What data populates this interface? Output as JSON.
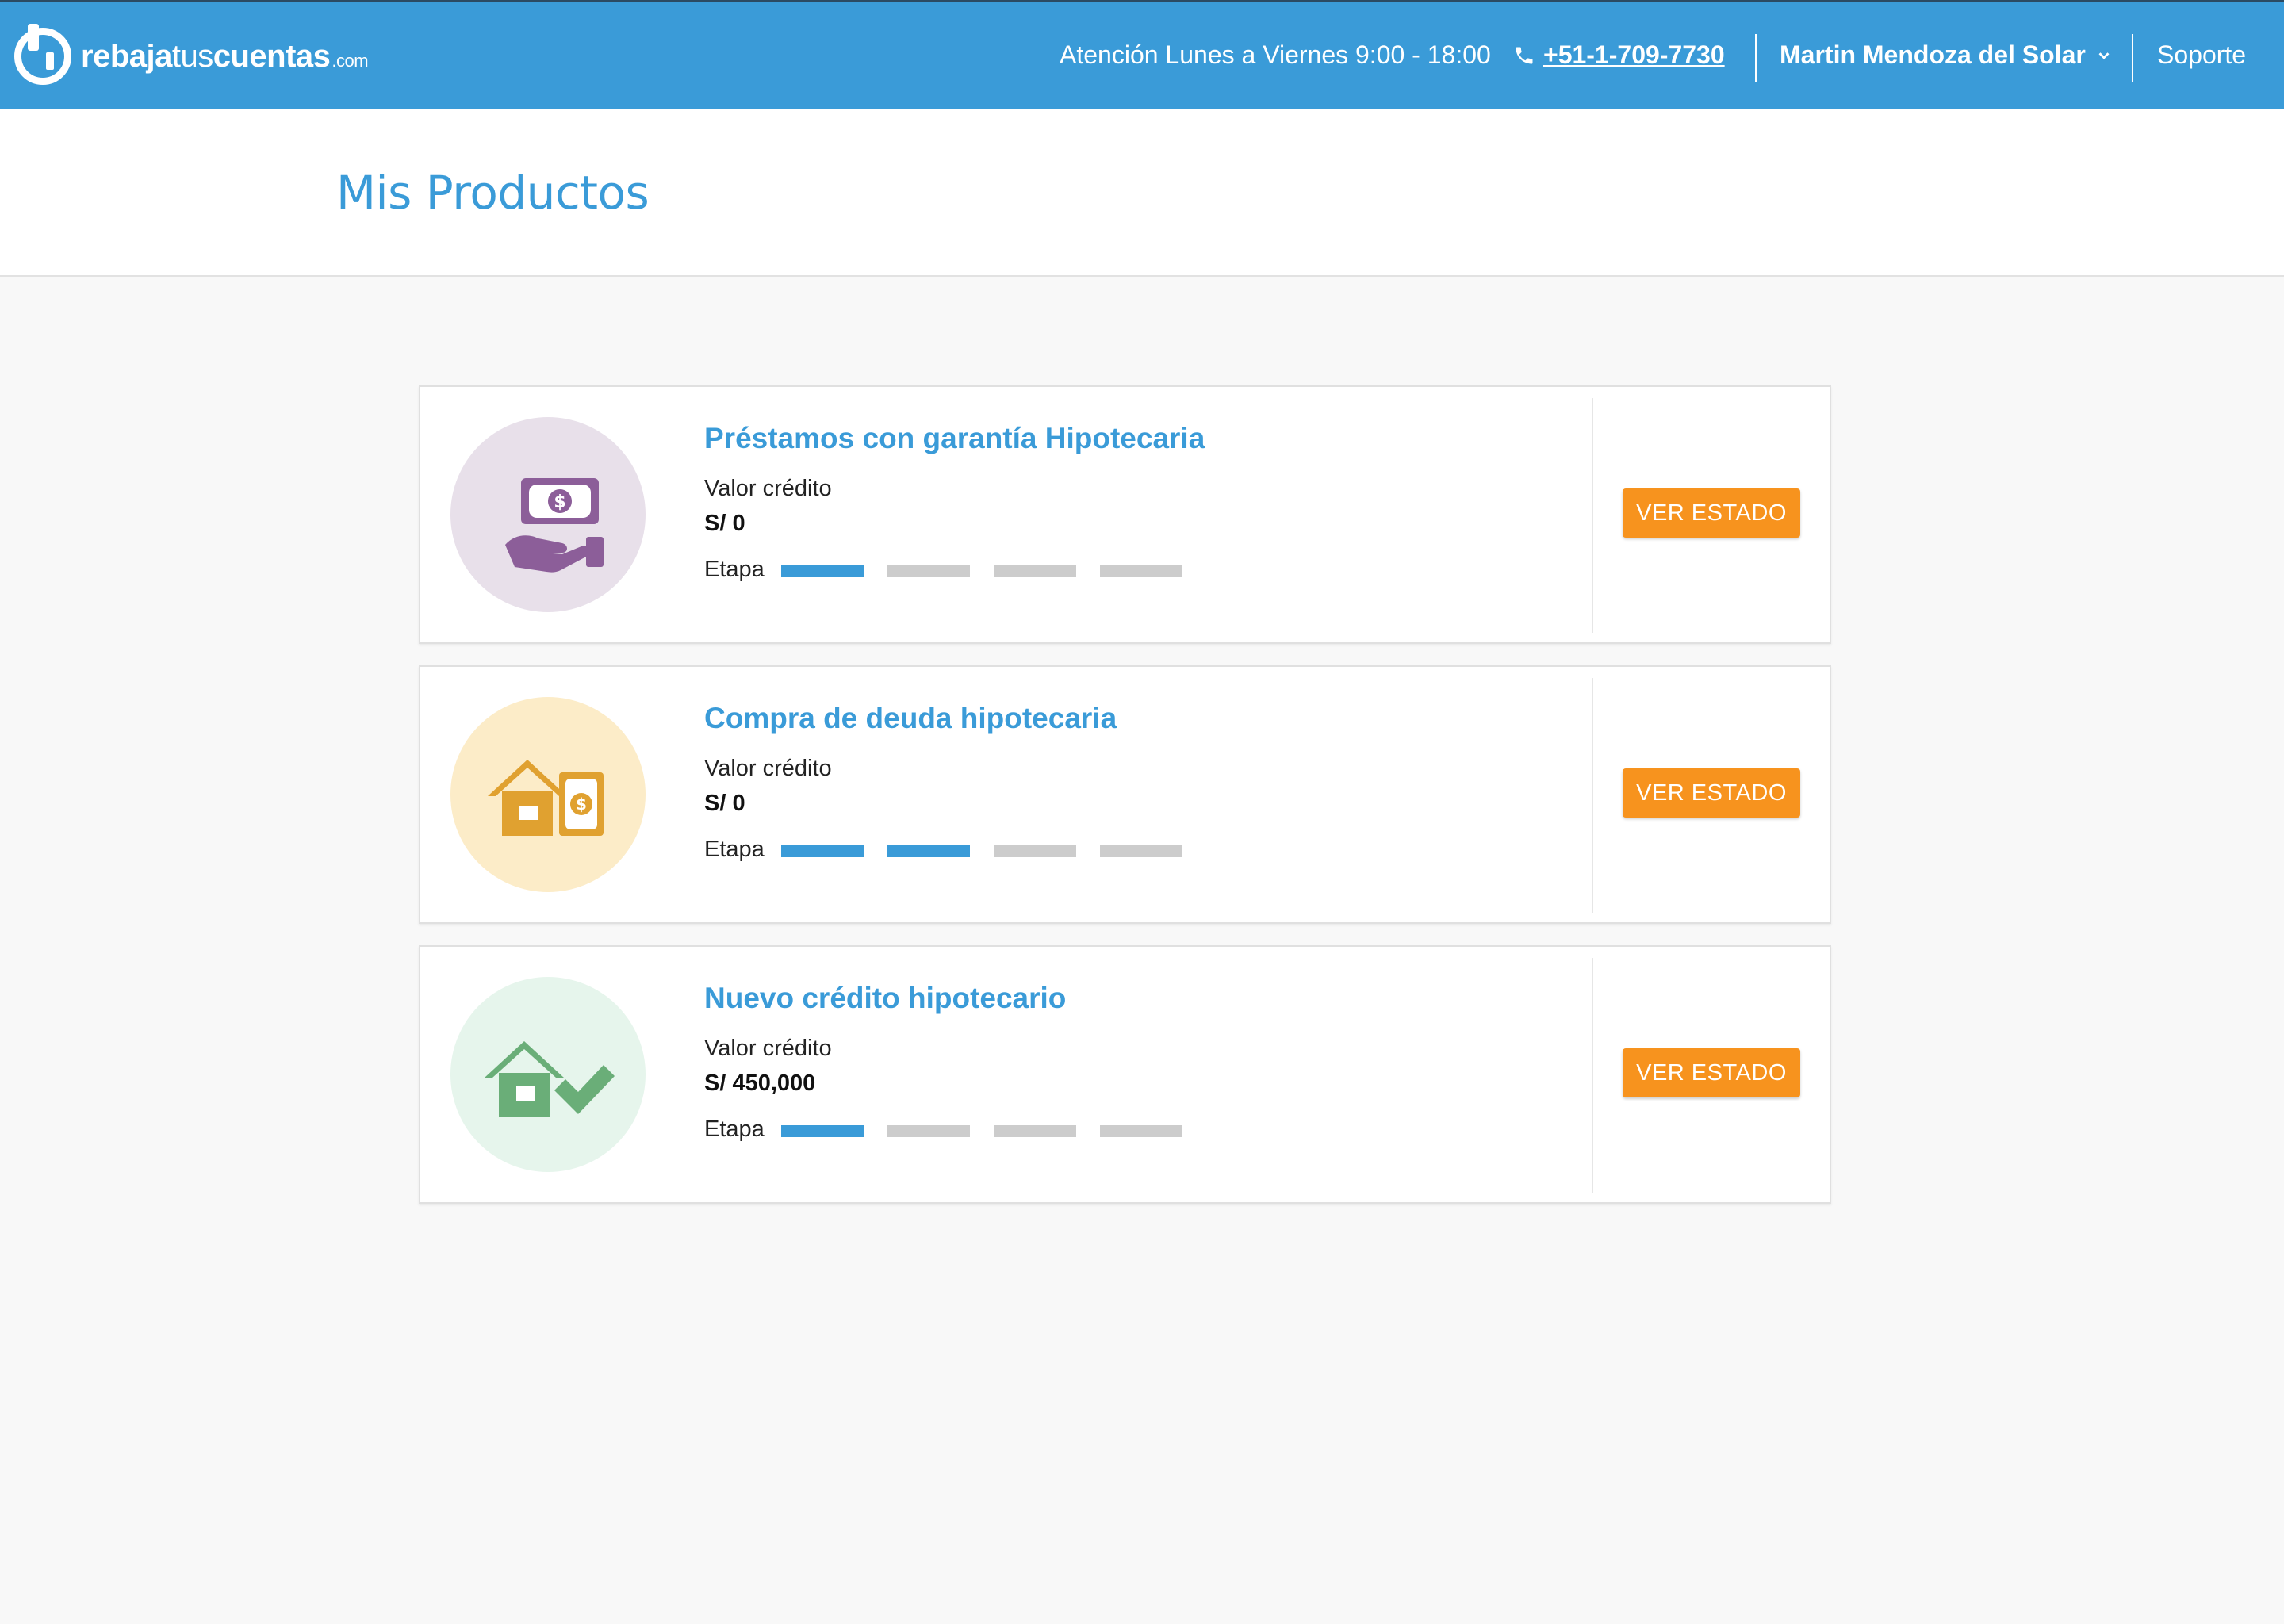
{
  "header": {
    "logo": {
      "bold": "rebaja",
      "thin": "tus",
      "bold2": "cuentas",
      "suffix": ".com"
    },
    "hours": "Atención Lunes a Viernes 9:00 - 18:00",
    "phone": "+51-1-709-7730",
    "user_name": "Martin Mendoza del Solar",
    "support": "Soporte",
    "bg_color": "#3a9bd8"
  },
  "page": {
    "title": "Mis Productos"
  },
  "products": [
    {
      "title": "Préstamos con garantía Hipotecaria",
      "value_label": "Valor crédito",
      "value": "S/ 0",
      "stage_label": "Etapa",
      "stage_done": 1,
      "stage_total": 4,
      "button": "VER ESTADO",
      "icon": "money-hand-icon",
      "icon_bg": "#e8e0ea",
      "icon_color": "#8c5e99"
    },
    {
      "title": "Compra de deuda hipotecaria",
      "value_label": "Valor crédito",
      "value": "S/ 0",
      "stage_label": "Etapa",
      "stage_done": 2,
      "stage_total": 4,
      "button": "VER ESTADO",
      "icon": "house-money-icon",
      "icon_bg": "#fcecc8",
      "icon_color": "#e0a130"
    },
    {
      "title": "Nuevo crédito hipotecario",
      "value_label": "Valor crédito",
      "value": "S/ 450,000",
      "stage_label": "Etapa",
      "stage_done": 1,
      "stage_total": 4,
      "button": "VER ESTADO",
      "icon": "house-check-icon",
      "icon_bg": "#e6f5ec",
      "icon_color": "#6aae78"
    }
  ],
  "colors": {
    "accent": "#3a9bd8",
    "button": "#f7931e",
    "stage_inactive": "#cccccc"
  }
}
